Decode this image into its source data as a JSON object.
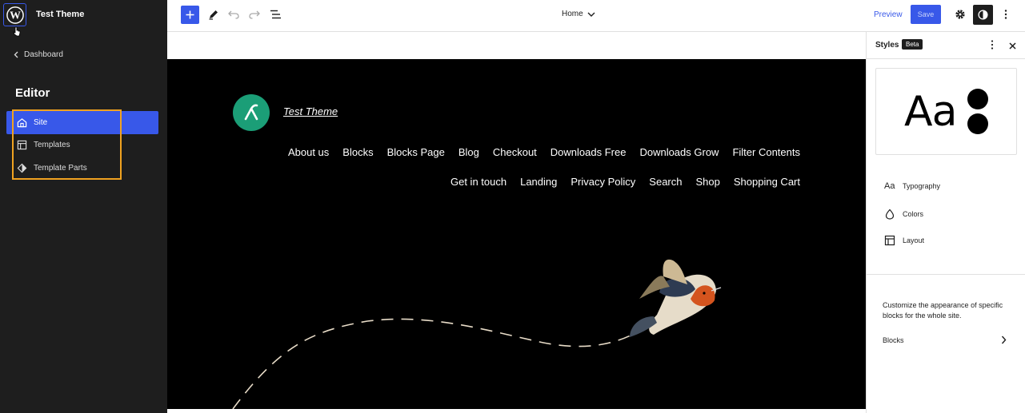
{
  "app": {
    "site_title": "Test Theme",
    "dashboard_label": "Dashboard",
    "editor_heading": "Editor"
  },
  "sidebar": {
    "items": [
      {
        "label": "Site",
        "icon": "home-icon",
        "active": true
      },
      {
        "label": "Templates",
        "icon": "layout-icon",
        "active": false
      },
      {
        "label": "Template Parts",
        "icon": "symbol-icon",
        "active": false
      }
    ]
  },
  "toolbar": {
    "document_title": "Home",
    "preview_label": "Preview",
    "save_label": "Save"
  },
  "canvas": {
    "site_name": "Test Theme",
    "menu_row1": [
      "About us",
      "Blocks",
      "Blocks Page",
      "Blog",
      "Checkout",
      "Downloads Free",
      "Downloads Grow",
      "Filter Contents"
    ],
    "menu_row2": [
      "Get in touch",
      "Landing",
      "Privacy Policy",
      "Search",
      "Shop",
      "Shopping Cart"
    ]
  },
  "styles_panel": {
    "title": "Styles",
    "badge": "Beta",
    "preview_text": "Aa",
    "nav": [
      {
        "label": "Typography",
        "icon": "typography-icon"
      },
      {
        "label": "Colors",
        "icon": "droplet-icon"
      },
      {
        "label": "Layout",
        "icon": "layout-icon"
      }
    ],
    "blocks_description": "Customize the appearance of specific blocks for the whole site.",
    "blocks_label": "Blocks"
  },
  "colors": {
    "accent": "#3858e9",
    "sidebar_bg": "#1e1e1e",
    "highlight": "#f0a220",
    "logo_green": "#1b9e77"
  }
}
